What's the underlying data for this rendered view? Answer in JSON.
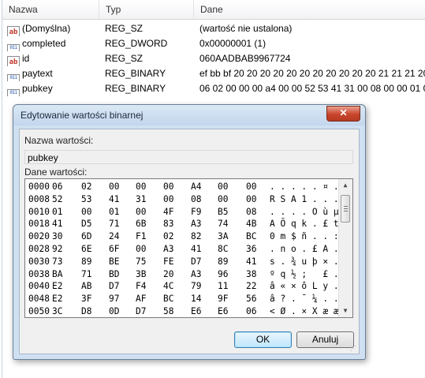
{
  "list": {
    "columns": [
      "Nazwa",
      "Typ",
      "Dane"
    ],
    "rows": [
      {
        "icon": "ab",
        "name": "(Domyślna)",
        "type": "REG_SZ",
        "data": "(wartość nie ustalona)"
      },
      {
        "icon": "011",
        "name": "completed",
        "type": "REG_DWORD",
        "data": "0x00000001 (1)"
      },
      {
        "icon": "ab",
        "name": "id",
        "type": "REG_SZ",
        "data": "060AADBAB9967724"
      },
      {
        "icon": "011",
        "name": "paytext",
        "type": "REG_BINARY",
        "data": "ef bb bf 20 20 20 20 20 20 20 20 20 20 20 21 21 21 20 5"
      },
      {
        "icon": "011",
        "name": "pubkey",
        "type": "REG_BINARY",
        "data": "06 02 00 00 00 a4 00 00 52 53 41 31 00 08 00 00 01 00 01 0"
      }
    ]
  },
  "dialog": {
    "title": "Edytowanie wartości binarnej",
    "close_label": "✕",
    "value_name_label": "Nazwa wartości:",
    "value_name": "pubkey",
    "value_data_label": "Dane wartości:",
    "hex_rows": [
      {
        "offset": "0000",
        "bytes": [
          "06",
          "02",
          "00",
          "00",
          "00",
          "A4",
          "00",
          "00"
        ],
        "ascii": ". . . . . ¤ . ."
      },
      {
        "offset": "0008",
        "bytes": [
          "52",
          "53",
          "41",
          "31",
          "00",
          "08",
          "00",
          "00"
        ],
        "ascii": "R S A 1 . . . ."
      },
      {
        "offset": "0010",
        "bytes": [
          "01",
          "00",
          "01",
          "00",
          "4F",
          "F9",
          "B5",
          "08"
        ],
        "ascii": ". . . . O ù µ ."
      },
      {
        "offset": "0018",
        "bytes": [
          "41",
          "D5",
          "71",
          "6B",
          "83",
          "A3",
          "74",
          "4B"
        ],
        "ascii": "A Õ q k . £ t K"
      },
      {
        "offset": "0020",
        "bytes": [
          "30",
          "6D",
          "24",
          "F1",
          "02",
          "82",
          "3A",
          "BC"
        ],
        "ascii": "0 m $ ñ . . : ¼"
      },
      {
        "offset": "0028",
        "bytes": [
          "92",
          "6E",
          "6F",
          "00",
          "A3",
          "41",
          "8C",
          "36"
        ],
        "ascii": ". n o . £ A . 6"
      },
      {
        "offset": "0030",
        "bytes": [
          "73",
          "89",
          "BE",
          "75",
          "FE",
          "D7",
          "89",
          "41"
        ],
        "ascii": "s . ¾ u þ × . A"
      },
      {
        "offset": "0038",
        "bytes": [
          "BA",
          "71",
          "BD",
          "3B",
          "20",
          "A3",
          "96",
          "38"
        ],
        "ascii": "º q ½ ;   £ . 8"
      },
      {
        "offset": "0040",
        "bytes": [
          "E2",
          "AB",
          "D7",
          "F4",
          "4C",
          "79",
          "11",
          "22"
        ],
        "ascii": "â « × ô L y . \""
      },
      {
        "offset": "0048",
        "bytes": [
          "E2",
          "3F",
          "97",
          "AF",
          "BC",
          "14",
          "9F",
          "56"
        ],
        "ascii": "â ? . ¯ ¼ . . V"
      },
      {
        "offset": "0050",
        "bytes": [
          "3C",
          "D8",
          "0D",
          "D7",
          "58",
          "E6",
          "E6",
          "06"
        ],
        "ascii": "< Ø . × X æ æ ."
      }
    ],
    "ok_label": "OK",
    "cancel_label": "Anuluj"
  }
}
